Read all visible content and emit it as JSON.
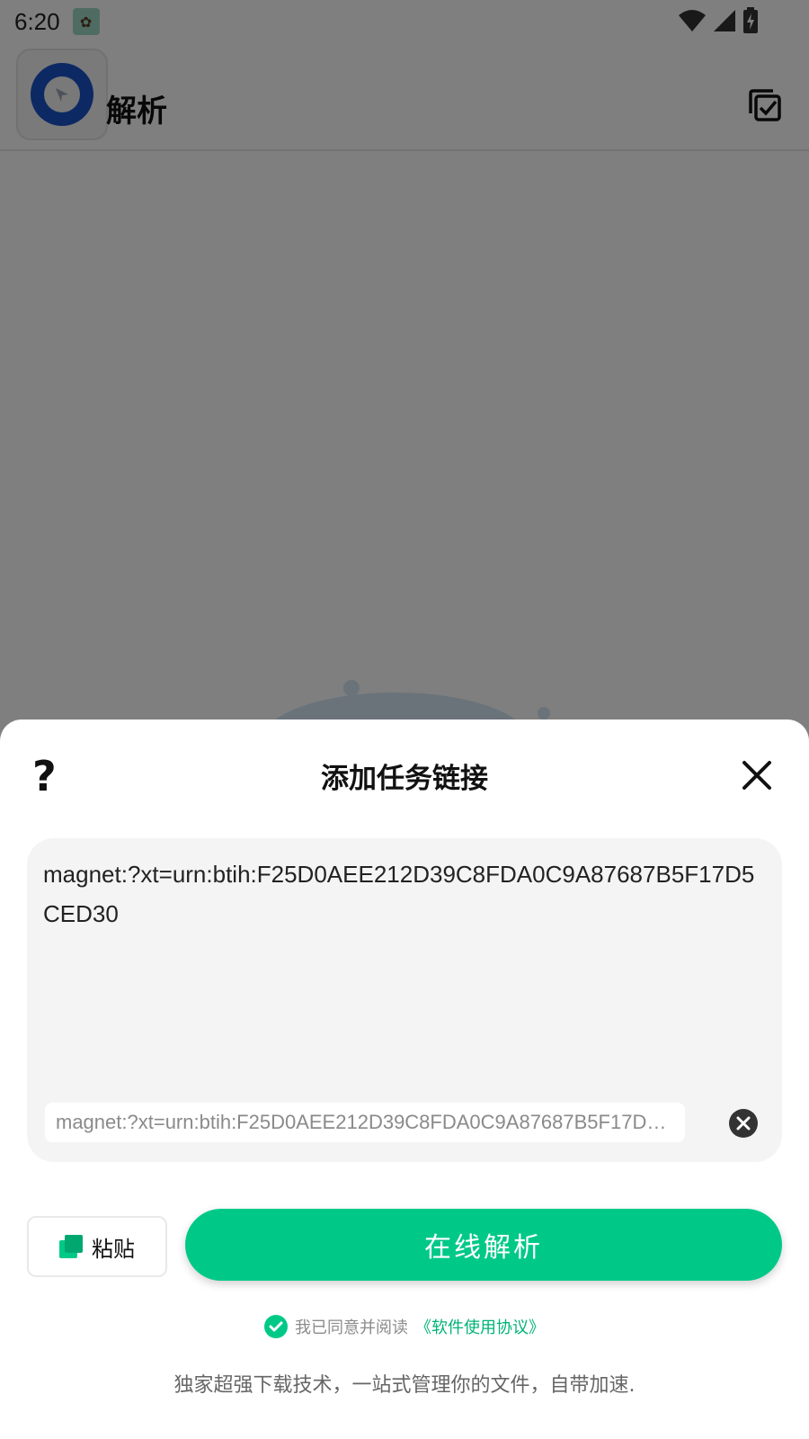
{
  "status_bar": {
    "time": "6:20"
  },
  "app_bar": {
    "title": "解析"
  },
  "sheet": {
    "title": "添加任务链接",
    "help_glyph": "?",
    "link_input_value": "magnet:?xt=urn:btih:F25D0AEE212D39C8FDA0C9A87687B5F17D5CED30",
    "suggestion": "magnet:?xt=urn:btih:F25D0AEE212D39C8FDA0C9A87687B5F17D5CED30",
    "paste_label": "粘贴",
    "parse_label": "在线解析",
    "agreement_prefix": "我已同意并阅读",
    "agreement_link": "《软件使用协议》",
    "tagline": "独家超强下载技术，一站式管理你的文件，自带加速."
  },
  "colors": {
    "accent": "#00c987",
    "link": "#00b377",
    "scrim": "rgba(0,0,0,0.5)"
  },
  "icons": {
    "help": "question-mark-icon",
    "close": "close-icon",
    "clear": "clear-circle-icon",
    "paste": "paste-icon",
    "agree": "check-circle-icon",
    "select_all": "select-all-icon"
  }
}
